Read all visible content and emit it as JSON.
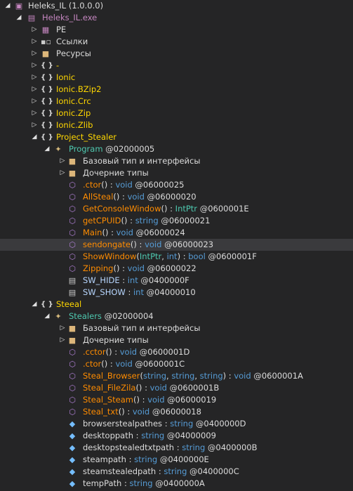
{
  "tree": {
    "assembly": {
      "arrow": "◢",
      "label": "Heleks_IL (1.0.0.0)"
    },
    "module": {
      "arrow": "◢",
      "label": "Heleks_IL.exe"
    },
    "pe": {
      "arrow": "▷",
      "label": "PE"
    },
    "refs": {
      "arrow": "▷",
      "label": "Ссылки"
    },
    "resources": {
      "arrow": "▷",
      "label": "Ресурсы"
    },
    "ns_dash": {
      "arrow": "▷",
      "label": "-"
    },
    "ns_ionic": {
      "arrow": "▷",
      "label": "Ionic"
    },
    "ns_bzip2": {
      "arrow": "▷",
      "label": "Ionic.BZip2"
    },
    "ns_crc": {
      "arrow": "▷",
      "label": "Ionic.Crc"
    },
    "ns_zip": {
      "arrow": "▷",
      "label": "Ionic.Zip"
    },
    "ns_zlib": {
      "arrow": "▷",
      "label": "Ionic.Zlib"
    },
    "ns_project": {
      "arrow": "◢",
      "label": "Project_Stealer"
    },
    "program": {
      "arrow": "◢",
      "name": "Program",
      "token": " @02000005"
    },
    "program_base": {
      "arrow": "▷",
      "label": "Базовый тип и интерфейсы"
    },
    "program_derived": {
      "arrow": "▷",
      "label": "Дочерние типы"
    },
    "p_ctor": {
      "name": ".ctor",
      "sig": "()",
      "colon": " : ",
      "ret": "void",
      "token": " @06000025"
    },
    "p_allsteal": {
      "name": "AllSteal",
      "sig": "()",
      "colon": " : ",
      "ret": "void",
      "token": " @06000020"
    },
    "p_getconsole": {
      "name": "GetConsoleWindow",
      "sig": "()",
      "colon": " : ",
      "ret": "IntPtr",
      "token": " @0600001E"
    },
    "p_getcpuid": {
      "name": "getCPUID",
      "sig": "()",
      "colon": " : ",
      "ret": "string",
      "token": " @06000021"
    },
    "p_main": {
      "name": "Main",
      "sig": "()",
      "colon": " : ",
      "ret": "void",
      "token": " @06000024"
    },
    "p_sendongate": {
      "name": "sendongate",
      "sig": "()",
      "colon": " : ",
      "ret": "void",
      "token": " @06000023"
    },
    "p_showwindow": {
      "name": "ShowWindow",
      "open": "(",
      "arg1": "IntPtr",
      "sep": ", ",
      "arg2": "int",
      "close": ")",
      "colon": " : ",
      "ret": "bool",
      "token": " @0600001F"
    },
    "p_zipping": {
      "name": "Zipping",
      "sig": "()",
      "colon": " : ",
      "ret": "void",
      "token": " @06000022"
    },
    "p_swhide": {
      "name": "SW_HIDE",
      "colon": " : ",
      "ret": "int",
      "token": " @0400000F"
    },
    "p_swshow": {
      "name": "SW_SHOW",
      "colon": " : ",
      "ret": "int",
      "token": " @04000010"
    },
    "ns_steeal": {
      "arrow": "◢",
      "label": "Steeal"
    },
    "stealers": {
      "arrow": "◢",
      "name": "Stealers",
      "token": " @02000004"
    },
    "stealers_base": {
      "arrow": "▷",
      "label": "Базовый тип и интерфейсы"
    },
    "stealers_derived": {
      "arrow": "▷",
      "label": "Дочерние типы"
    },
    "s_cctor": {
      "name": ".cctor",
      "sig": "()",
      "colon": " : ",
      "ret": "void",
      "token": " @0600001D"
    },
    "s_ctor": {
      "name": ".ctor",
      "sig": "()",
      "colon": " : ",
      "ret": "void",
      "token": " @0600001C"
    },
    "s_browser": {
      "name": "Steal_Browser",
      "open": "(",
      "arg1": "string",
      "sep": ", ",
      "arg2": "string",
      "sep2": ", ",
      "arg3": "string",
      "close": ")",
      "colon": " : ",
      "ret": "void",
      "token": " @0600001A"
    },
    "s_filezila": {
      "name": "Steal_FileZila",
      "sig": "()",
      "colon": " : ",
      "ret": "void",
      "token": " @0600001B"
    },
    "s_steam": {
      "name": "Steal_Steam",
      "sig": "()",
      "colon": " : ",
      "ret": "void",
      "token": " @06000019"
    },
    "s_txt": {
      "name": "Steal_txt",
      "sig": "()",
      "colon": " : ",
      "ret": "void",
      "token": " @06000018"
    },
    "f_browserpathes": {
      "name": "browserstealpathes",
      "colon": " : ",
      "ret": "string",
      "token": " @0400000D"
    },
    "f_desktoppath": {
      "name": "desktoppath",
      "colon": " : ",
      "ret": "string",
      "token": " @04000009"
    },
    "f_desktoptxt": {
      "name": "desktopstealedtxtpath",
      "colon": " : ",
      "ret": "string",
      "token": " @0400000B"
    },
    "f_steampath": {
      "name": "steampath",
      "colon": " : ",
      "ret": "string",
      "token": " @0400000E"
    },
    "f_steamstealed": {
      "name": "steamstealedpath",
      "colon": " : ",
      "ret": "string",
      "token": " @0400000C"
    },
    "f_temppath": {
      "name": "tempPath",
      "colon": " : ",
      "ret": "string",
      "token": " @0400000A"
    }
  },
  "icons": {
    "assembly": "assembly-icon",
    "module": "module-icon",
    "pe": "pe-icon",
    "refs": "references-icon",
    "folder": "folder-icon",
    "namespace": "namespace-icon",
    "class": "class-icon",
    "method": "method-icon",
    "field": "field-icon",
    "constant": "constant-icon"
  },
  "colors": {
    "background": "#252526",
    "selected": "#3a3a3d",
    "namespace": "#ffd700",
    "class": "#4ec9b0",
    "method": "#ff8c00",
    "keyword": "#569cd6",
    "text": "#dcdcdc"
  }
}
